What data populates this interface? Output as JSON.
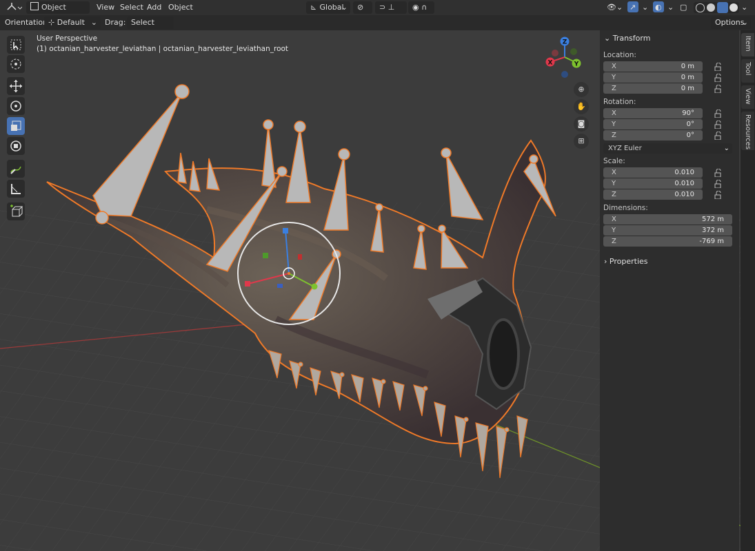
{
  "header": {
    "mode": "Object Mode",
    "menus": [
      "View",
      "Select",
      "Add",
      "Object"
    ],
    "transform_orientation": "Global"
  },
  "tool_settings": {
    "orientation_label": "Orientation:",
    "orientation_value": "Default",
    "drag_label": "Drag:",
    "drag_value": "Select Box",
    "options": "Options"
  },
  "viewport": {
    "perspective": "User Perspective",
    "object_info": "(1) octanian_harvester_leviathan | octanian_harvester_leviathan_root",
    "gizmo": {
      "x": "X",
      "y": "Y",
      "z": "Z"
    }
  },
  "sidebar": {
    "transform_title": "Transform",
    "location_label": "Location:",
    "location": [
      {
        "axis": "X",
        "value": "0 m"
      },
      {
        "axis": "Y",
        "value": "0 m"
      },
      {
        "axis": "Z",
        "value": "0 m"
      }
    ],
    "rotation_label": "Rotation:",
    "rotation": [
      {
        "axis": "X",
        "value": "90°"
      },
      {
        "axis": "Y",
        "value": "0°"
      },
      {
        "axis": "Z",
        "value": "0°"
      }
    ],
    "rotation_mode": "XYZ Euler",
    "scale_label": "Scale:",
    "scale": [
      {
        "axis": "X",
        "value": "0.010"
      },
      {
        "axis": "Y",
        "value": "0.010"
      },
      {
        "axis": "Z",
        "value": "0.010"
      }
    ],
    "dimensions_label": "Dimensions:",
    "dimensions": [
      {
        "axis": "X",
        "value": "572 m"
      },
      {
        "axis": "Y",
        "value": "372 m"
      },
      {
        "axis": "Z",
        "value": "-769 m"
      }
    ],
    "properties_title": "Properties"
  },
  "tabs": [
    "Item",
    "Tool",
    "View",
    "Resources"
  ],
  "colors": {
    "accent": "#4772b3",
    "selection_outline": "#f07a28",
    "x_axis": "#e0384b",
    "y_axis": "#7ec22e",
    "z_axis": "#3a7fe0"
  }
}
